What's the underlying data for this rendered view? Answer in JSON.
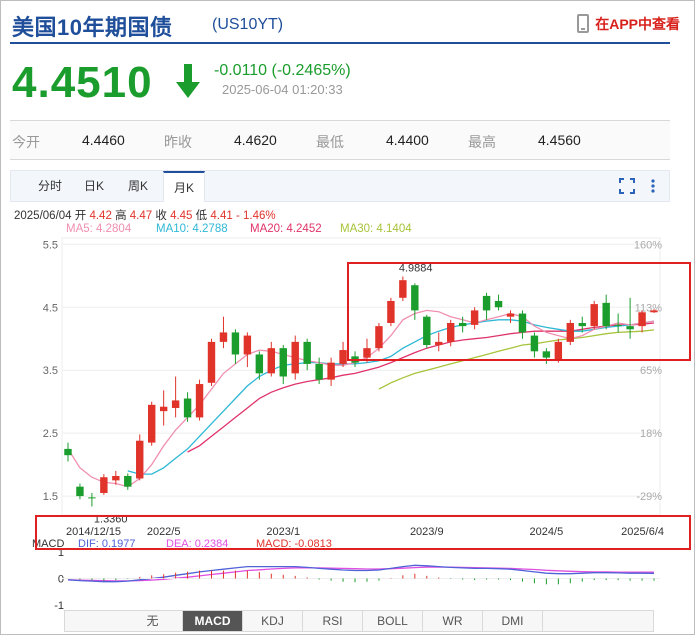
{
  "header": {
    "title": "美国10年期国债",
    "code": "(US10YT)",
    "app_link": "在APP中查看"
  },
  "quote": {
    "price": "4.4510",
    "change": "-0.0110 (-0.2465%)",
    "time": "2025-06-04 01:20:33",
    "open_label": "今开",
    "open": "4.4460",
    "prev_label": "昨收",
    "prev": "4.4620",
    "low_label": "最低",
    "low": "4.4400",
    "high_label": "最高",
    "high": "4.4560"
  },
  "tabs": [
    "分时",
    "日K",
    "周K",
    "月K"
  ],
  "active_tab": "月K",
  "ohlc_info": {
    "date": "2025/06/04",
    "open_label": "开",
    "open": "4.42",
    "high_label": "高",
    "high": "4.47",
    "close_label": "收",
    "close": "4.45",
    "low_label": "低",
    "low": "4.41",
    "pct": "- 1.46%"
  },
  "ma_info": {
    "ma5": "MA5: 4.2804",
    "ma10": "MA10: 4.2788",
    "ma20": "MA20: 4.2452",
    "ma30": "MA30: 4.1404"
  },
  "macd_info": {
    "macd": "MACD",
    "dif": "DIF: 0.1977",
    "dea": "DEA: 0.2384",
    "macd_val": "MACD: -0.0813"
  },
  "indicators": [
    "无",
    "MACD",
    "KDJ",
    "RSI",
    "BOLL",
    "WR",
    "DMI"
  ],
  "active_indicator": "MACD",
  "colors": {
    "up": "#e0332a",
    "down": "#1a9d2c",
    "ma5": "#f08fb0",
    "ma10": "#2eb8d6",
    "ma20": "#e0336a",
    "ma30": "#a7c43a",
    "dif": "#4f62d8",
    "dea": "#e04fe0",
    "highlight": "#e02020"
  },
  "chart_data": {
    "type": "candlestick",
    "y_ticks": [
      "5.5",
      "4.5",
      "3.5",
      "2.5",
      "1.5"
    ],
    "y_ticks_right": [
      "160%",
      "113%",
      "65%",
      "18%",
      "-29%"
    ],
    "x_ticks": [
      "2014/12/15",
      "2022/5",
      "2023/1",
      "2023/9",
      "2024/5",
      "2025/6/4"
    ],
    "ylim": [
      1.2,
      5.6
    ],
    "max_label": "4.9884",
    "min_label": "1.3360",
    "macd_ticks": [
      "1",
      "0",
      "-1"
    ],
    "candles": [
      [
        2.25,
        2.15,
        2.35,
        2.05
      ],
      [
        1.65,
        1.5,
        1.7,
        1.45
      ],
      [
        1.48,
        1.47,
        1.55,
        1.336
      ],
      [
        1.55,
        1.8,
        1.85,
        1.52
      ],
      [
        1.75,
        1.82,
        1.9,
        1.68
      ],
      [
        1.82,
        1.65,
        1.86,
        1.6
      ],
      [
        1.78,
        2.38,
        2.48,
        1.75
      ],
      [
        2.35,
        2.95,
        3.0,
        2.3
      ],
      [
        2.85,
        2.92,
        3.18,
        2.62
      ],
      [
        2.9,
        3.02,
        3.4,
        2.75
      ],
      [
        3.05,
        2.75,
        3.15,
        2.68
      ],
      [
        2.75,
        3.28,
        3.35,
        2.7
      ],
      [
        3.3,
        3.95,
        4.0,
        3.25
      ],
      [
        3.95,
        4.1,
        4.35,
        3.85
      ],
      [
        4.1,
        3.75,
        4.15,
        3.6
      ],
      [
        3.75,
        4.05,
        4.1,
        3.55
      ],
      [
        3.75,
        3.45,
        3.8,
        3.35
      ],
      [
        3.45,
        3.85,
        3.95,
        3.4
      ],
      [
        3.85,
        3.4,
        3.9,
        3.28
      ],
      [
        3.45,
        3.95,
        4.05,
        3.35
      ],
      [
        3.95,
        3.6,
        4.0,
        3.5
      ],
      [
        3.6,
        3.35,
        3.7,
        3.28
      ],
      [
        3.35,
        3.62,
        3.7,
        3.25
      ],
      [
        3.6,
        3.82,
        3.95,
        3.55
      ],
      [
        3.72,
        3.62,
        3.8,
        3.55
      ],
      [
        3.7,
        3.85,
        4.0,
        3.62
      ],
      [
        3.85,
        4.2,
        4.25,
        3.8
      ],
      [
        4.25,
        4.6,
        4.65,
        4.2
      ],
      [
        4.65,
        4.93,
        4.99,
        4.6
      ],
      [
        4.85,
        4.45,
        4.88,
        4.3
      ],
      [
        4.35,
        3.9,
        4.38,
        3.85
      ],
      [
        3.9,
        3.95,
        4.1,
        3.8
      ],
      [
        3.95,
        4.25,
        4.3,
        3.88
      ],
      [
        4.25,
        4.2,
        4.35,
        4.1
      ],
      [
        4.22,
        4.45,
        4.5,
        4.15
      ],
      [
        4.68,
        4.45,
        4.73,
        4.3
      ],
      [
        4.6,
        4.5,
        4.7,
        4.45
      ],
      [
        4.35,
        4.4,
        4.45,
        4.25
      ],
      [
        4.4,
        4.1,
        4.45,
        4.0
      ],
      [
        4.05,
        3.8,
        4.1,
        3.7
      ],
      [
        3.8,
        3.7,
        3.85,
        3.6
      ],
      [
        3.65,
        3.95,
        4.0,
        3.62
      ],
      [
        3.95,
        4.25,
        4.3,
        3.9
      ],
      [
        4.25,
        4.2,
        4.35,
        4.1
      ],
      [
        4.2,
        4.55,
        4.6,
        4.15
      ],
      [
        4.57,
        4.2,
        4.7,
        4.15
      ],
      [
        4.22,
        4.21,
        4.4,
        4.1
      ],
      [
        4.2,
        4.15,
        4.65,
        4.0
      ],
      [
        4.2,
        4.42,
        4.45,
        4.1
      ],
      [
        4.42,
        4.45,
        4.47,
        4.41
      ]
    ],
    "ma5": [
      2.25,
      1.95,
      1.8,
      1.72,
      1.7,
      1.65,
      1.78,
      2.0,
      2.3,
      2.55,
      2.75,
      2.95,
      3.2,
      3.45,
      3.6,
      3.75,
      3.82,
      3.8,
      3.75,
      3.7,
      3.65,
      3.62,
      3.58,
      3.58,
      3.62,
      3.7,
      3.85,
      4.05,
      4.3,
      4.4,
      4.45,
      4.43,
      4.35,
      4.3,
      4.25,
      4.3,
      4.35,
      4.4,
      4.35,
      4.2,
      4.1,
      4.05,
      4.0,
      4.05,
      4.15,
      4.2,
      4.25,
      4.22,
      4.25,
      4.28
    ],
    "ma10": [
      null,
      null,
      null,
      null,
      null,
      1.9,
      1.85,
      1.85,
      1.95,
      2.1,
      2.25,
      2.45,
      2.65,
      2.85,
      3.05,
      3.25,
      3.4,
      3.5,
      3.58,
      3.6,
      3.62,
      3.62,
      3.6,
      3.6,
      3.6,
      3.62,
      3.65,
      3.72,
      3.85,
      3.95,
      4.05,
      4.12,
      4.18,
      4.22,
      4.25,
      4.28,
      4.3,
      4.3,
      4.28,
      4.22,
      4.18,
      4.15,
      4.12,
      4.12,
      4.15,
      4.18,
      4.2,
      4.22,
      4.25,
      4.28
    ],
    "ma20": [
      null,
      null,
      null,
      null,
      null,
      null,
      null,
      null,
      null,
      null,
      2.2,
      2.3,
      2.45,
      2.6,
      2.75,
      2.9,
      3.05,
      3.15,
      3.22,
      3.28,
      3.32,
      3.35,
      3.38,
      3.42,
      3.45,
      3.5,
      3.55,
      3.62,
      3.7,
      3.78,
      3.85,
      3.9,
      3.95,
      3.98,
      4.0,
      4.02,
      4.05,
      4.08,
      4.1,
      4.12,
      4.12,
      4.12,
      4.12,
      4.15,
      4.18,
      4.2,
      4.22,
      4.22,
      4.23,
      4.25
    ],
    "ma30": [
      null,
      null,
      null,
      null,
      null,
      null,
      null,
      null,
      null,
      null,
      null,
      null,
      null,
      null,
      null,
      null,
      null,
      null,
      null,
      null,
      null,
      null,
      null,
      null,
      null,
      null,
      3.2,
      3.3,
      3.38,
      3.45,
      3.5,
      3.55,
      3.6,
      3.65,
      3.7,
      3.75,
      3.8,
      3.85,
      3.9,
      3.92,
      3.95,
      3.98,
      4.0,
      4.02,
      4.05,
      4.08,
      4.1,
      4.11,
      4.12,
      4.14
    ],
    "dif": [
      -0.05,
      -0.08,
      -0.1,
      -0.12,
      -0.12,
      -0.1,
      -0.05,
      0.0,
      0.05,
      0.12,
      0.18,
      0.25,
      0.3,
      0.35,
      0.4,
      0.45,
      0.45,
      0.45,
      0.45,
      0.45,
      0.42,
      0.38,
      0.35,
      0.32,
      0.3,
      0.3,
      0.32,
      0.38,
      0.45,
      0.5,
      0.48,
      0.45,
      0.42,
      0.4,
      0.38,
      0.38,
      0.37,
      0.35,
      0.3,
      0.25,
      0.2,
      0.18,
      0.18,
      0.2,
      0.22,
      0.22,
      0.21,
      0.2,
      0.2,
      0.1977
    ],
    "dea": [
      -0.05,
      -0.06,
      -0.07,
      -0.08,
      -0.09,
      -0.09,
      -0.08,
      -0.06,
      -0.03,
      0.01,
      0.05,
      0.1,
      0.15,
      0.2,
      0.25,
      0.3,
      0.33,
      0.36,
      0.38,
      0.4,
      0.4,
      0.4,
      0.39,
      0.38,
      0.37,
      0.36,
      0.36,
      0.37,
      0.39,
      0.41,
      0.43,
      0.43,
      0.43,
      0.42,
      0.41,
      0.4,
      0.39,
      0.38,
      0.36,
      0.34,
      0.31,
      0.29,
      0.27,
      0.26,
      0.25,
      0.25,
      0.24,
      0.24,
      0.24,
      0.2384
    ]
  }
}
